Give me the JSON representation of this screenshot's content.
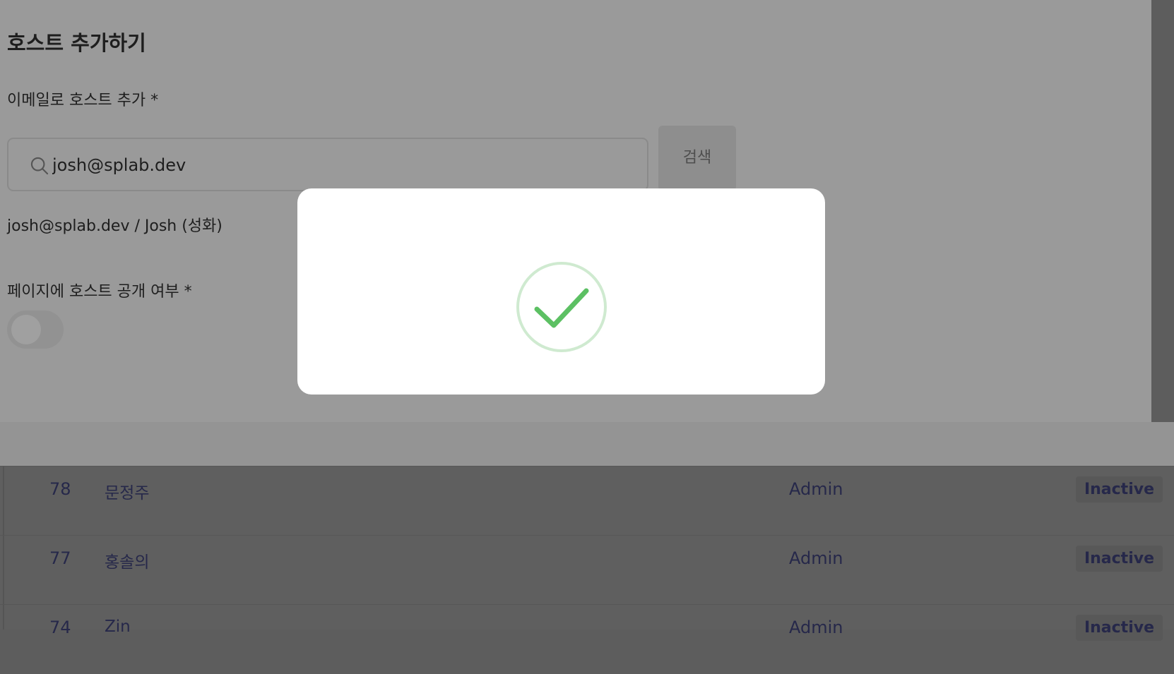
{
  "form": {
    "title": "호스트 추가하기",
    "email_label": "이메일로 호스트 추가 *",
    "search_value": "josh@splab.dev",
    "search_button": "검색",
    "search_result": "josh@splab.dev / Josh (성화)",
    "visibility_label": "페이지에 호스트 공개 여부 *",
    "visibility_on": false
  },
  "table": {
    "rows": [
      {
        "id": "78",
        "name": "문정주",
        "role": "Admin",
        "status": "Inactive"
      },
      {
        "id": "77",
        "name": "홍솔의",
        "role": "Admin",
        "status": "Inactive"
      },
      {
        "id": "74",
        "name": "Zin",
        "role": "Admin",
        "status": "Inactive"
      }
    ]
  },
  "modal": {
    "icon": "success-check-icon",
    "accent": "#5cc063"
  }
}
